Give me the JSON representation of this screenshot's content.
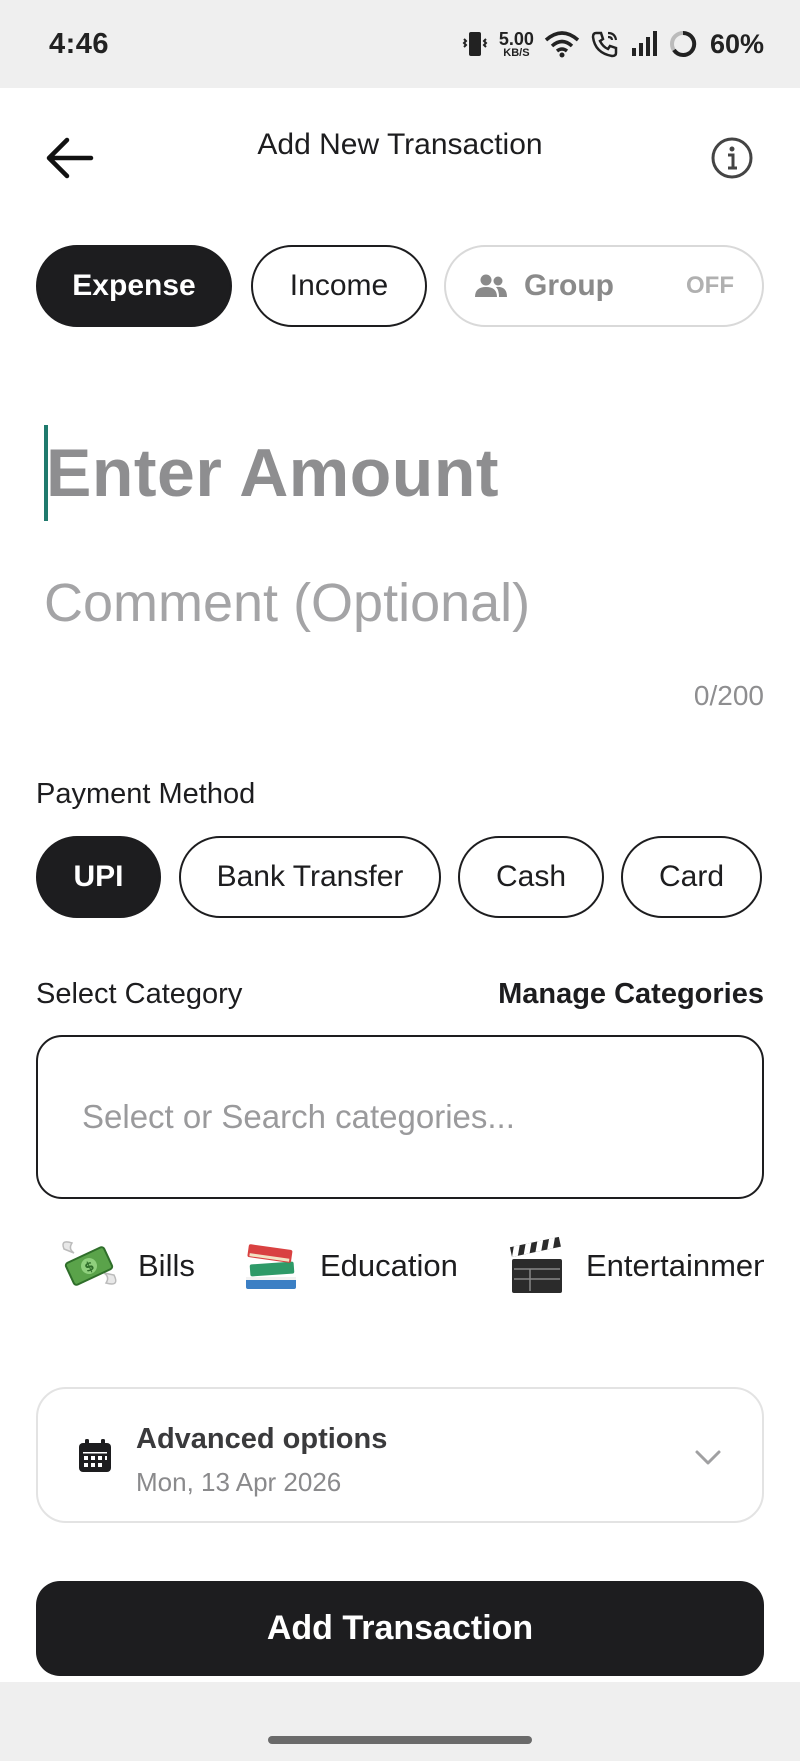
{
  "status_bar": {
    "time": "4:46",
    "net_speed_value": "5.00",
    "net_speed_unit": "KB/S",
    "battery": "60%",
    "icons": [
      "vibrate-icon",
      "wifi-icon",
      "wifi-call-icon",
      "signal-icon",
      "battery-icon"
    ]
  },
  "header": {
    "title": "Add New Transaction",
    "back_icon": "arrow-left-icon",
    "info_icon": "info-icon"
  },
  "transaction_type": {
    "expense": "Expense",
    "income": "Income",
    "group": "Group",
    "group_state": "OFF",
    "selected": "Expense"
  },
  "amount": {
    "placeholder": "Enter Amount",
    "value": ""
  },
  "comment": {
    "placeholder": "Comment (Optional)",
    "value": "",
    "counter": "0/200"
  },
  "payment": {
    "label": "Payment Method",
    "methods": [
      "UPI",
      "Bank Transfer",
      "Cash",
      "Card"
    ],
    "selected": "UPI"
  },
  "category": {
    "label": "Select Category",
    "manage": "Manage Categories",
    "search_placeholder": "Select or Search categories...",
    "chips": [
      {
        "label": "Bills",
        "icon": "money-with-wings-icon"
      },
      {
        "label": "Education",
        "icon": "books-icon"
      },
      {
        "label": "Entertainment",
        "icon": "clapper-board-icon"
      }
    ]
  },
  "advanced": {
    "title": "Advanced options",
    "date": "Mon, 13 Apr 2026"
  },
  "submit": {
    "label": "Add Transaction"
  },
  "colors": {
    "primary": "#1d1d1f",
    "caret": "#1f7a6d",
    "placeholder": "#8e8e90",
    "muted_border": "#e3e3e3"
  }
}
